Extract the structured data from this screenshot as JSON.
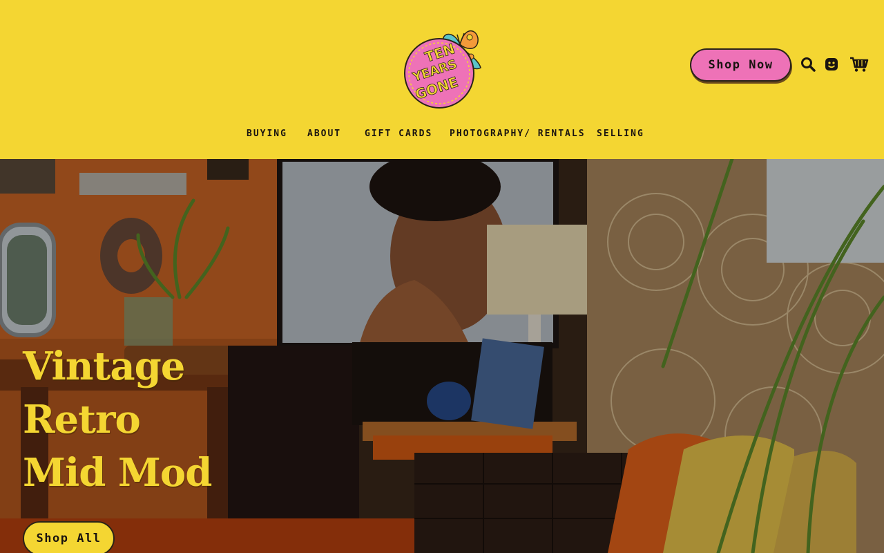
{
  "header": {
    "logo": {
      "lines": [
        "TEN",
        "YEARS",
        "GONE"
      ],
      "colors": {
        "badge": "#ee72b7",
        "wing": "#5bc4c8",
        "wing_accent": "#f39a3a"
      }
    },
    "shop_now_label": "Shop Now",
    "icons": [
      "search-icon",
      "account-smiley-icon",
      "cart-icon"
    ]
  },
  "nav": {
    "items": [
      "BUYING",
      "ABOUT",
      "GIFT CARDS",
      "PHOTOGRAPHY/ RENTALS",
      "SELLING"
    ]
  },
  "hero": {
    "lines": [
      "Vintage",
      "Retro",
      "Mid Mod"
    ],
    "cta_label": "Shop All"
  },
  "colors": {
    "brand_yellow": "#f4d632",
    "brand_pink": "#ee72b7",
    "text_dark": "#1a1410"
  }
}
